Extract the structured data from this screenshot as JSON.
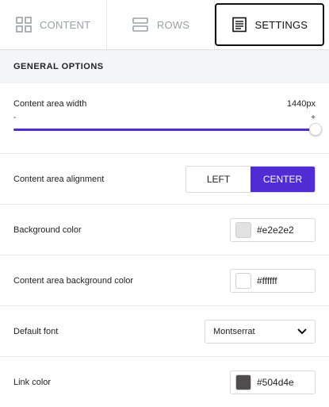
{
  "tabs": [
    {
      "label": "CONTENT",
      "icon": "grid-icon"
    },
    {
      "label": "ROWS",
      "icon": "rows-icon"
    },
    {
      "label": "SETTINGS",
      "icon": "settings-doc-icon"
    }
  ],
  "general": {
    "title": "GENERAL OPTIONS",
    "content_width": {
      "label": "Content area width",
      "value": "1440px",
      "min_symbol": "-",
      "max_symbol": "+",
      "slider_fraction": 1.0
    },
    "alignment": {
      "label": "Content area alignment",
      "options": [
        "LEFT",
        "CENTER"
      ],
      "selected": "CENTER"
    },
    "background_color": {
      "label": "Background color",
      "hex": "#e2e2e2",
      "swatch_color": "#e2e2e2"
    },
    "content_bg_color": {
      "label": "Content area background color",
      "hex": "#ffffff",
      "swatch_color": "#ffffff"
    },
    "default_font": {
      "label": "Default font",
      "value": "Montserrat"
    },
    "link_color": {
      "label": "Link color",
      "hex": "#504d4e",
      "swatch_color": "#504d4e"
    }
  },
  "colors": {
    "accent": "#4f2cd3"
  }
}
